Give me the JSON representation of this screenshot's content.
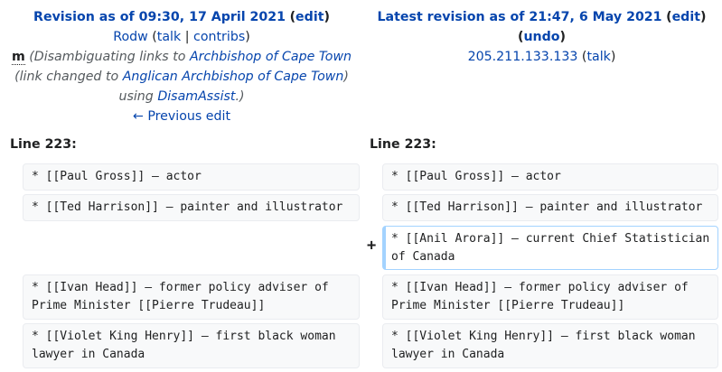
{
  "left": {
    "revision_prefix": "Revision as of 09:30, 17 April 2021",
    "edit_label": "edit",
    "user": "Rodw",
    "talk": "talk",
    "separator": "|",
    "contribs": "contribs",
    "minor_flag": "m",
    "summary_1": "(Disambiguating links to ",
    "summary_link_1": "Archbishop of Cape Town",
    "summary_2": "(link changed to ",
    "summary_link_2": "Anglican Archbishop of Cape Town",
    "summary_3": ") using ",
    "summary_link_3": "DisamAssist",
    "summary_4": ".)",
    "previous_edit": "← Previous edit",
    "line_label": "Line 223:"
  },
  "right": {
    "revision_prefix": "Latest revision as of 21:47, 6 May 2021",
    "edit_label": "edit",
    "undo_label": "undo",
    "ip": "205.211.133.133",
    "talk": "talk",
    "line_label": "Line 223:"
  },
  "diff": {
    "added_marker": "+",
    "rows": [
      {
        "left": "* [[Paul Gross]] – actor",
        "right": "* [[Paul Gross]] – actor"
      },
      {
        "left": "* [[Ted Harrison]] – painter and illustrator",
        "right": "* [[Ted Harrison]] – painter and illustrator"
      },
      {
        "left": "",
        "right": "* [[Anil Arora]] – current Chief Statistician of Canada"
      },
      {
        "left": "* [[Ivan Head]] – former policy adviser of Prime Minister [[Pierre Trudeau]]",
        "right": "* [[Ivan Head]] – former policy adviser of Prime Minister [[Pierre Trudeau]]"
      },
      {
        "left": "* [[Violet King Henry]] – first black woman lawyer in Canada",
        "right": "* [[Violet King Henry]] – first black woman lawyer in Canada"
      }
    ]
  },
  "colors": {
    "link": "#0645ad",
    "context_bg": "#f8f9fa",
    "context_border": "#eaecf0",
    "added_border": "#a3d3ff"
  }
}
